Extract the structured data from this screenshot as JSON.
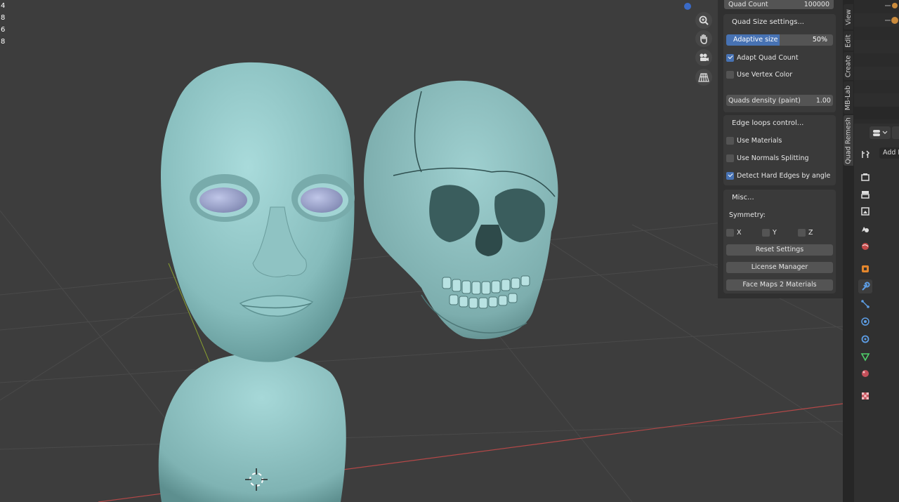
{
  "viewport": {
    "stats": [
      "4",
      "8",
      "6",
      "8"
    ]
  },
  "npanel": {
    "quad_count": {
      "label": "Quad Count",
      "value": "100000"
    },
    "quad_size": {
      "title": "Quad Size settings...",
      "adaptive": {
        "label": "Adaptive size",
        "value": "50%",
        "fraction": 0.5
      },
      "adapt_quad_count": {
        "label": "Adapt Quad Count",
        "checked": true
      },
      "use_vertex_color": {
        "label": "Use Vertex Color",
        "checked": false
      },
      "quads_density": {
        "label": "Quads density (paint)",
        "value": "1.00"
      }
    },
    "edge_loops": {
      "title": "Edge loops control...",
      "use_materials": {
        "label": "Use Materials",
        "checked": false
      },
      "use_normals": {
        "label": "Use Normals Splitting",
        "checked": false
      },
      "detect_hard": {
        "label": "Detect Hard Edges by angle",
        "checked": true
      }
    },
    "misc": {
      "title": "Misc...",
      "symmetry": "Symmetry:",
      "x": "X",
      "y": "Y",
      "z": "Z",
      "reset": "Reset Settings",
      "license": "License Manager",
      "facemaps": "Face Maps 2 Materials"
    }
  },
  "tabs": [
    "View",
    "Edit",
    "Create",
    "MB-Lab",
    "Quad Remesh"
  ],
  "props": {
    "add_label": "Add M"
  },
  "colors": {
    "accent": "#4772b3",
    "model": "#9ccccc",
    "grid_red": "#b44848"
  }
}
